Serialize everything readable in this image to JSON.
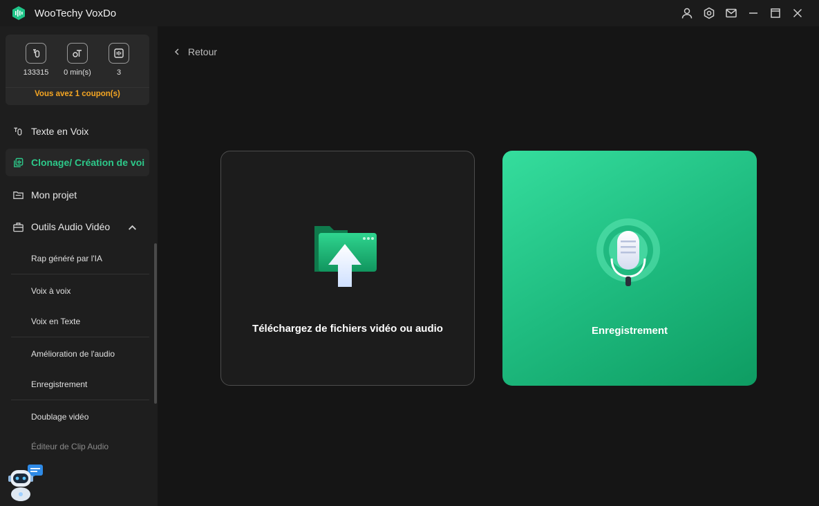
{
  "app": {
    "title": "WooTechy VoxDo"
  },
  "stats": {
    "characters": "133315",
    "minutes": "0 min(s)",
    "count": "3",
    "coupon": "Vous avez 1 coupon(s)"
  },
  "sidebar": {
    "items": [
      {
        "label": "Texte en Voix",
        "icon": "text-voice-icon"
      },
      {
        "label": "Clonage/ Création de voi",
        "icon": "clone-icon",
        "active": true
      },
      {
        "label": "Mon projet",
        "icon": "folder-icon"
      },
      {
        "label": "Outils Audio Vidéo",
        "icon": "toolbox-icon",
        "expanded": true
      }
    ],
    "subitems": [
      {
        "label": "Rap généré par l'IA"
      },
      {
        "label": "Voix à voix"
      },
      {
        "label": "Voix en Texte"
      },
      {
        "label": "Amélioration de l'audio"
      },
      {
        "label": "Enregistrement"
      },
      {
        "label": "Doublage vidéo"
      },
      {
        "label": "Éditeur de Clip Audio"
      }
    ]
  },
  "main": {
    "back_label": "Retour",
    "upload_label": "Téléchargez de fichiers vidéo ou audio",
    "record_label": "Enregistrement"
  },
  "colors": {
    "accent": "#2dc98a",
    "coupon": "#f5a623",
    "background": "#151515",
    "sidebar": "#1e1e1e"
  }
}
